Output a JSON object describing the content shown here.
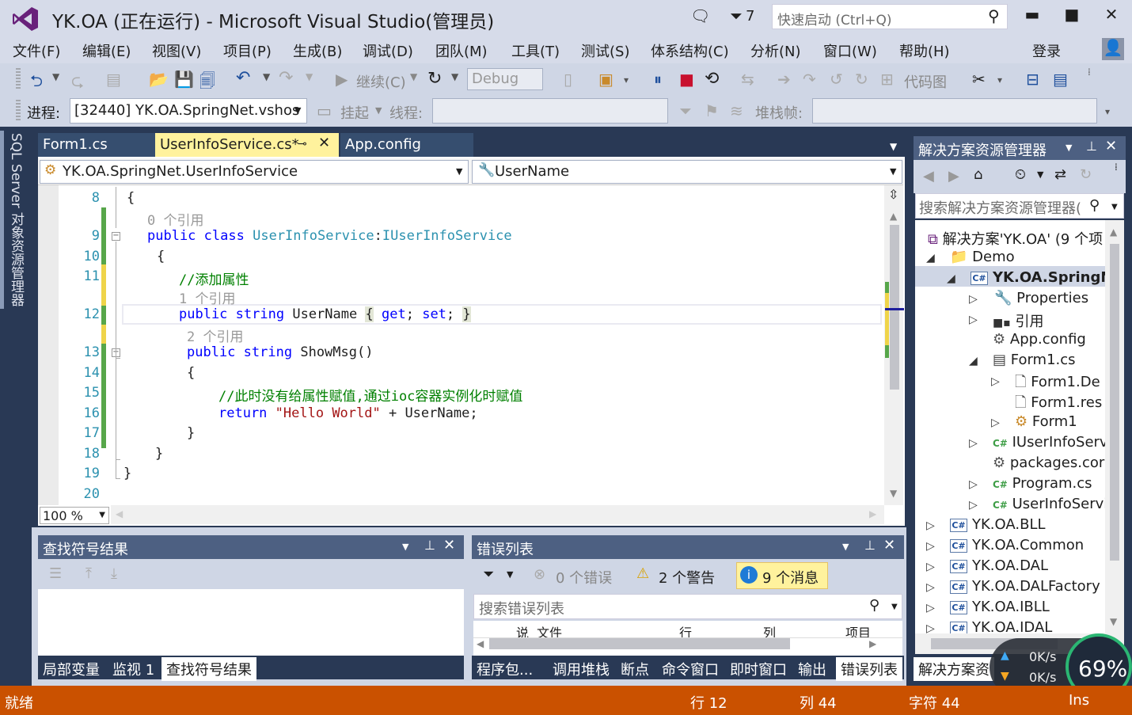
{
  "window": {
    "title": "YK.OA (正在运行) - Microsoft Visual Studio(管理员)",
    "notif_count": "7",
    "quick_launch_placeholder": "快速启动 (Ctrl+Q)",
    "minimize": "▬",
    "maximize": "■",
    "close": "✕"
  },
  "menu": [
    "文件(F)",
    "编辑(E)",
    "视图(V)",
    "项目(P)",
    "生成(B)",
    "调试(D)",
    "团队(M)",
    "工具(T)",
    "测试(S)",
    "体系结构(C)",
    "分析(N)",
    "窗口(W)",
    "帮助(H)"
  ],
  "login": "登录",
  "toolbar": {
    "continue": "继续(C)",
    "config": "Debug",
    "code_map": "代码图"
  },
  "toolbar2": {
    "process_label": "进程:",
    "process_value": "[32440] YK.OA.SpringNet.vshos",
    "suspend": "挂起",
    "thread": "线程:",
    "stack_frame": "堆栈帧:"
  },
  "sidebar": {
    "label": "SQL Server 对象资源管理器"
  },
  "tabs": [
    "Form1.cs",
    "UserInfoService.cs*",
    "App.config"
  ],
  "nav": {
    "class": "YK.OA.SpringNet.UserInfoService",
    "member": "UserName"
  },
  "zoom": "100 %",
  "code": {
    "l8": "8",
    "l9": "9",
    "l10": "10",
    "l11": "11",
    "l12": "12",
    "l13": "13",
    "l14": "14",
    "l15": "15",
    "l16": "16",
    "l17": "17",
    "l18": "18",
    "l19": "19",
    "l20": "20",
    "open_brace": "{",
    "close_brace": "}",
    "lens_0": "0 个引用",
    "lens_1": "1 个引用",
    "lens_2": "2 个引用",
    "kw_public": "public",
    "kw_class": "class",
    "cls_name": "UserInfoService",
    "colon": ":",
    "iface": "IUserInfoService",
    "comment1": "//添加属性",
    "kw_string": "string",
    "prop": "UserName",
    "brace_l": "{",
    "kw_get": "get",
    "semi": ";",
    "kw_set": "set",
    "brace_r": "}",
    "method": "ShowMsg()",
    "comment2": "//此时没有给属性赋值,通过ioc容器实例化时赋值",
    "kw_return": "return",
    "str": "\"Hello World\"",
    "plus": " + UserName;"
  },
  "find_panel": {
    "title": "查找符号结果",
    "tabs": [
      "局部变量",
      "监视 1",
      "查找符号结果"
    ]
  },
  "error_panel": {
    "title": "错误列表",
    "errors": "0 个错误",
    "warnings": "2 个警告",
    "messages": "9 个消息",
    "search_placeholder": "搜索错误列表",
    "cols": [
      "说",
      "文件",
      "行",
      "列",
      "项目"
    ],
    "tabs": [
      "程序包...",
      "调用堆栈",
      "断点",
      "命令窗口",
      "即时窗口",
      "输出",
      "错误列表"
    ]
  },
  "solution": {
    "title": "解决方案资源管理器",
    "search_placeholder": "搜索解决方案资源管理器(",
    "items": [
      "解决方案'YK.OA' (9 个项",
      "Demo",
      "YK.OA.SpringN",
      "Properties",
      "引用",
      "App.config",
      "Form1.cs",
      "Form1.De",
      "Form1.res",
      "Form1",
      "IUserInfoServ",
      "packages.cor",
      "Program.cs",
      "UserInfoServi",
      "YK.OA.BLL",
      "YK.OA.Common",
      "YK.OA.DAL",
      "YK.OA.DALFactory",
      "YK.OA.IBLL",
      "YK.OA.IDAL"
    ],
    "bottom_tab": "解决方案资"
  },
  "network": {
    "up": "0K/s",
    "down": "0K/s",
    "cpu": "69%"
  },
  "status": {
    "ready": "就绪",
    "line": "行 12",
    "col": "列 44",
    "char": "字符 44",
    "mode": "Ins"
  },
  "colors": {
    "status": "#ca5100",
    "accent": "#293955",
    "tab_active": "#fff29d"
  }
}
